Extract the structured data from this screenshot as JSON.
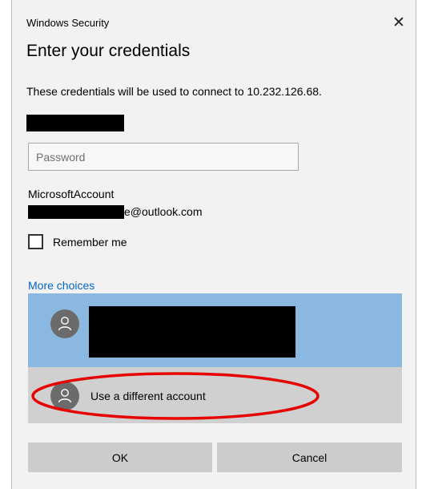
{
  "window": {
    "title": "Windows Security",
    "close_glyph": "✕"
  },
  "heading": "Enter your credentials",
  "description": "These credentials will be used to connect to 10.232.126.68.",
  "password": {
    "placeholder": "Password",
    "value": ""
  },
  "account": {
    "type": "MicrosoftAccount",
    "email_visible": "e@outlook.com"
  },
  "remember": {
    "label": "Remember me",
    "checked": false
  },
  "more_choices": {
    "label": "More choices",
    "different_account_label": "Use a different account",
    "icons": {
      "avatar": "person-icon"
    }
  },
  "buttons": {
    "ok": "OK",
    "cancel": "Cancel"
  },
  "colors": {
    "selected_account_bg": "#8bb8e0",
    "different_account_bg": "#d0d0d0",
    "link": "#0067c0",
    "annotation": "#e60000"
  }
}
